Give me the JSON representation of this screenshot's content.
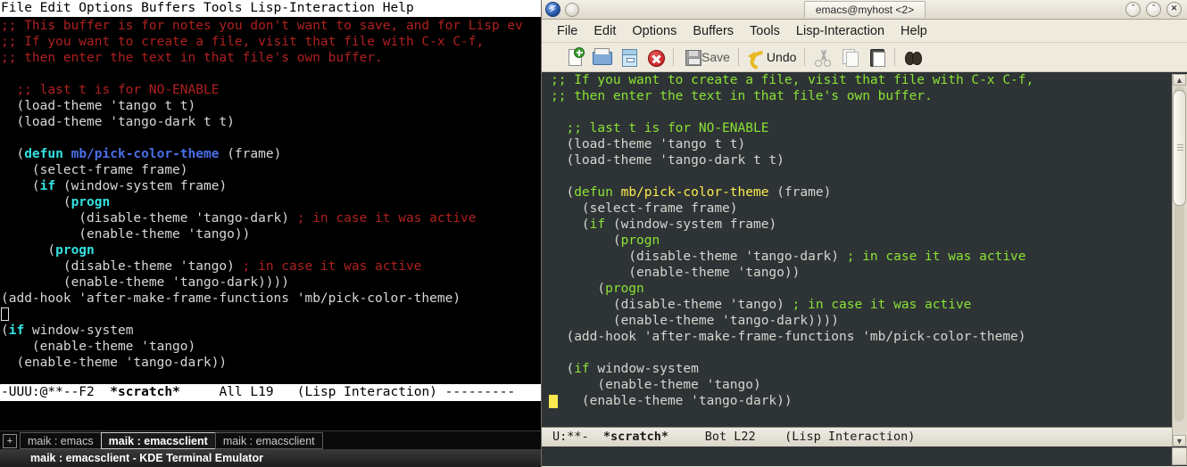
{
  "terminal": {
    "menubar": "File Edit Options Buffers Tools Lisp-Interaction Help",
    "lines": [
      {
        "text": ";; This buffer is for notes you don't want to save, and for Lisp ev",
        "cls": "t-com"
      },
      {
        "text": ";; If you want to create a file, visit that file with C-x C-f,",
        "cls": "t-com"
      },
      {
        "text": ";; then enter the text in that file's own buffer.",
        "cls": "t-com"
      }
    ],
    "code": [
      "  ;; last t is for NO-ENABLE",
      "  (load-theme 'tango t t)",
      "  (load-theme 'tango-dark t t)",
      "",
      "  (defun mb/pick-color-theme (frame)",
      "    (select-frame frame)",
      "    (if (window-system frame)",
      "        (progn",
      "          (disable-theme 'tango-dark) ; in case it was active",
      "          (enable-theme 'tango))",
      "      (progn",
      "        (disable-theme 'tango) ; in case it was active",
      "        (enable-theme 'tango-dark))))",
      "(add-hook 'after-make-frame-functions 'mb/pick-color-theme)",
      "",
      "(if window-system",
      "    (enable-theme 'tango)",
      "  (enable-theme 'tango-dark))"
    ],
    "modeline": {
      "flags": "-UUU:@**--F2",
      "buffer": "*scratch*",
      "position": "All L19",
      "mode": "(Lisp Interaction)",
      "filler": "---------"
    }
  },
  "konsole": {
    "new_tab_label": "+",
    "tabs": [
      {
        "label": "maik : emacs",
        "active": false
      },
      {
        "label": "maik : emacsclient",
        "active": true
      },
      {
        "label": "maik : emacsclient",
        "active": false
      }
    ],
    "statusbar": "maik : emacsclient - KDE Terminal Emulator"
  },
  "emacs": {
    "window_title": "emacs@myhost <2>",
    "window_buttons": [
      {
        "name": "minimize-button",
        "glyph": "ˇ"
      },
      {
        "name": "maximize-button",
        "glyph": "ˆ"
      },
      {
        "name": "close-button",
        "glyph": "✕"
      }
    ],
    "menubar": [
      "File",
      "Edit",
      "Options",
      "Buffers",
      "Tools",
      "Lisp-Interaction",
      "Help"
    ],
    "toolbar": [
      {
        "name": "new-file-icon",
        "label": ""
      },
      {
        "name": "open-file-icon",
        "label": ""
      },
      {
        "name": "save-as-icon",
        "label": ""
      },
      {
        "name": "close-buffer-icon",
        "label": ""
      },
      {
        "name": "save-icon",
        "label": "Save",
        "disabled": true
      },
      {
        "name": "undo-icon",
        "label": "Undo",
        "disabled": false
      },
      {
        "name": "cut-icon",
        "label": ""
      },
      {
        "name": "copy-icon",
        "label": ""
      },
      {
        "name": "paste-icon",
        "label": ""
      },
      {
        "name": "search-icon",
        "label": ""
      }
    ],
    "buffer_lines": [
      ";; If you want to create a file, visit that file with C-x C-f,",
      ";; then enter the text in that file's own buffer.",
      "",
      "  ;; last t is for NO-ENABLE",
      "  (load-theme 'tango t t)",
      "  (load-theme 'tango-dark t t)",
      "",
      "  (defun mb/pick-color-theme (frame)",
      "    (select-frame frame)",
      "    (if (window-system frame)",
      "        (progn",
      "          (disable-theme 'tango-dark) ; in case it was active",
      "          (enable-theme 'tango))",
      "      (progn",
      "        (disable-theme 'tango) ; in case it was active",
      "        (enable-theme 'tango-dark))))",
      "  (add-hook 'after-make-frame-functions 'mb/pick-color-theme)",
      "",
      "  (if window-system",
      "      (enable-theme 'tango)",
      "    (enable-theme 'tango-dark))"
    ],
    "modeline": {
      "flags": "U:**-",
      "buffer": "*scratch*",
      "position": "Bot L22",
      "mode": "(Lisp Interaction)"
    },
    "scrollbar": {
      "up_arrow": "▲",
      "down_arrow": "▼"
    }
  },
  "colors": {
    "terminal_bg": "#000000",
    "terminal_fg": "#d8d8d8",
    "terminal_comment": "#b02020",
    "terminal_keyword": "#34e2e2",
    "terminal_function": "#4a6fe8",
    "emacs_bg": "#2e3436",
    "emacs_fg": "#d3d7cf",
    "emacs_comment": "#8ae234",
    "emacs_function": "#fce94f",
    "emacs_cursor": "#fce94f",
    "chrome_bg": "#eeeade"
  }
}
